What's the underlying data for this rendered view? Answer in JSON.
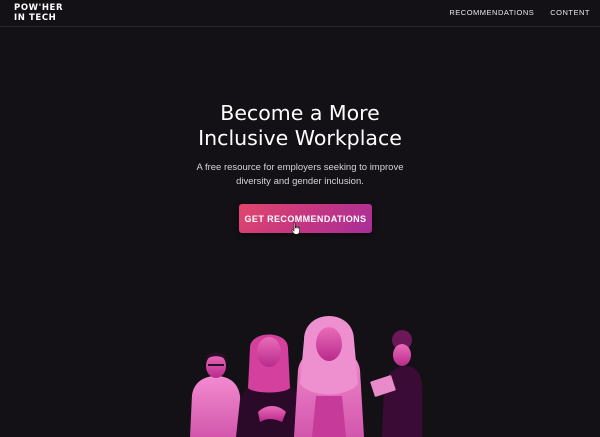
{
  "nav": {
    "logo_line1": "POW'HER",
    "logo_line2": "IN TECH",
    "links": [
      "RECOMMENDATIONS",
      "CONTENT"
    ]
  },
  "hero": {
    "title_line1": "Become a More",
    "title_line2": "Inclusive Workplace",
    "subtitle_line1": "A free resource for employers seeking to improve",
    "subtitle_line2": "diversity and gender inclusion.",
    "cta_label": "GET RECOMMENDATIONS"
  },
  "colors": {
    "background": "#141116",
    "accent_start": "#e2466d",
    "accent_end": "#a92e9a",
    "photo_tint": "#c22a9a"
  },
  "icons": [
    "hand-pointer-cursor-icon"
  ],
  "images": [
    "team-photo-illustration"
  ]
}
